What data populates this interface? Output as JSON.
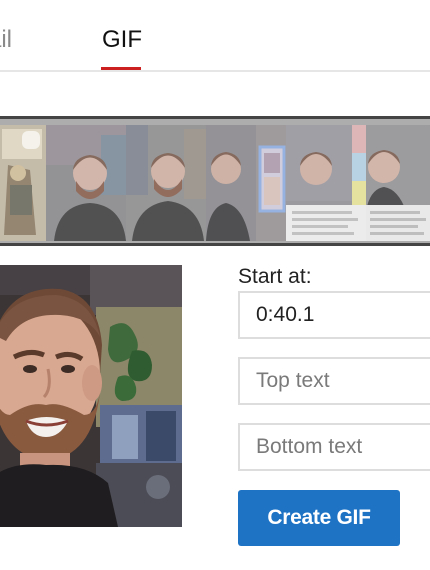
{
  "tabs": [
    {
      "label": "Thumbnail",
      "visible_label": "ail",
      "selected": false
    },
    {
      "label": "GIF",
      "selected": true
    }
  ],
  "accent_colors": {
    "tab_underline": "#cc1f1f",
    "primary_button": "#1e73c5"
  },
  "filmstrip": {
    "frames": [
      {
        "name": "comic-frame"
      },
      {
        "name": "host-frame-1"
      },
      {
        "name": "host-frame-2"
      },
      {
        "name": "comic-frame-2"
      },
      {
        "name": "host-frame-3"
      },
      {
        "name": "text-frame"
      }
    ]
  },
  "form": {
    "start_label": "Start at:",
    "start_value": "0:40.1",
    "top_text_placeholder": "Top text",
    "bottom_text_placeholder": "Bottom text",
    "create_button": "Create GIF"
  }
}
